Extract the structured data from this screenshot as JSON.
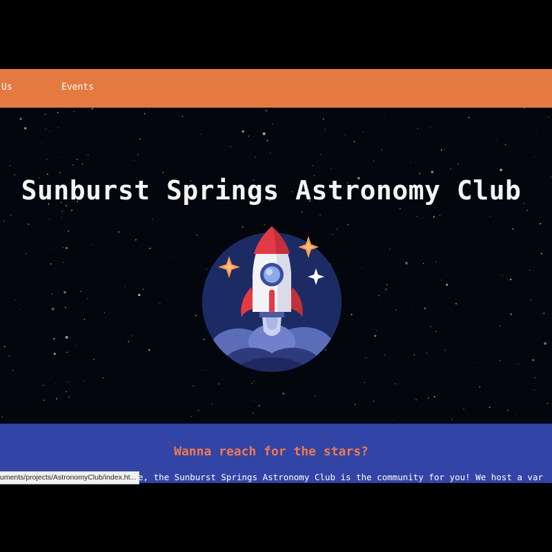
{
  "nav": {
    "items": [
      {
        "label": "Us"
      },
      {
        "label": "Events"
      }
    ]
  },
  "hero": {
    "title": "Sunburst Springs Astronomy Club",
    "logo_icon": "rocket-launch-icon"
  },
  "about": {
    "heading": "Wanna reach for the stars?",
    "body": "e, the Sunburst Springs Astronomy Club is the community for you! We host a var"
  },
  "status_bar": {
    "url": "uments/projects/AstronomyClub/index.ht..."
  },
  "colors": {
    "nav_bg": "#e57a41",
    "hero_bg": "#04060e",
    "about_bg": "#3244a6",
    "heading_accent": "#f07a4c"
  }
}
